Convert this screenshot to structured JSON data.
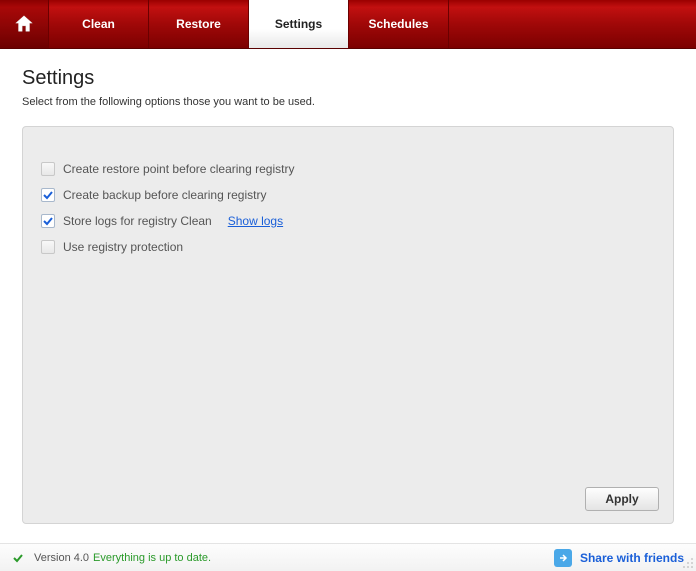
{
  "header": {
    "tabs": [
      {
        "label": "Clean",
        "active": false
      },
      {
        "label": "Restore",
        "active": false
      },
      {
        "label": "Settings",
        "active": true
      },
      {
        "label": "Schedules",
        "active": false
      }
    ]
  },
  "page": {
    "title": "Settings",
    "subtitle": "Select from the following options those you want to be used."
  },
  "options": [
    {
      "label": "Create restore point before clearing registry",
      "checked": false
    },
    {
      "label": "Create backup before clearing registry",
      "checked": true
    },
    {
      "label": "Store logs for registry Clean",
      "checked": true,
      "link": "Show logs"
    },
    {
      "label": "Use registry protection",
      "checked": false
    }
  ],
  "buttons": {
    "apply": "Apply"
  },
  "footer": {
    "version_label": "Version  4.0",
    "status": "Everything is up to date.",
    "share": "Share with friends"
  }
}
